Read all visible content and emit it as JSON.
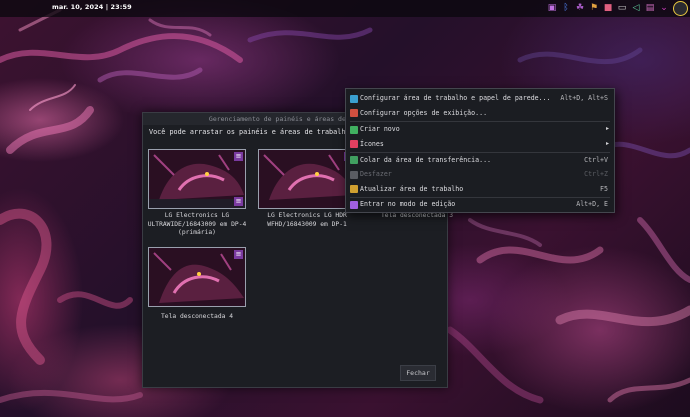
{
  "topbar": {
    "datetime": "mar. 10, 2024 | 23:59",
    "tray_icons": [
      "user-icon",
      "bluetooth-icon",
      "dragon-icon",
      "flag-icon",
      "lock-icon",
      "battery-icon",
      "volume-icon",
      "display-icon",
      "chevron-icon",
      "avatar-icon"
    ],
    "tray_colors": [
      "#c070e0",
      "#5080f0",
      "#b060d0",
      "#e0a040",
      "#e06080",
      "#d0d0d0",
      "#60d0a0",
      "#d070c0",
      "#d040c0",
      "#e8c840"
    ]
  },
  "dialog": {
    "title": "Gerenciamento de painéis e áreas de trabalho",
    "message": "Você pode arrastar os painéis e áreas de trabalho para outras telas.",
    "screens": [
      {
        "label": "LG Electronics LG ULTRAWIDE/16843009 em DP-4 (primária)",
        "has_image": true
      },
      {
        "label": "LG Electronics LG HDR WFHD/16843009 em DP-1",
        "has_image": true
      },
      {
        "label": "Tela desconectada 3",
        "has_image": false
      },
      {
        "label": "Tela desconectada 4",
        "has_image": true
      }
    ],
    "close_label": "Fechar",
    "menu_button_glyph": "≡"
  },
  "context_menu": {
    "items": [
      {
        "label": "Configurar área de trabalho e papel de parede...",
        "shortcut": "Alt+D, Alt+S",
        "icon": "desktop-settings-icon",
        "icon_color": "#3aa0d0",
        "submenu": false,
        "disabled": false
      },
      {
        "label": "Configurar opções de exibição...",
        "shortcut": "",
        "icon": "display-options-icon",
        "icon_color": "#d05040",
        "submenu": false,
        "disabled": false
      },
      {
        "label": "Criar novo",
        "shortcut": "",
        "icon": "create-new-icon",
        "icon_color": "#40b060",
        "submenu": true,
        "disabled": false
      },
      {
        "label": "Ícones",
        "shortcut": "",
        "icon": "icons-icon",
        "icon_color": "#e04060",
        "submenu": true,
        "disabled": false
      },
      {
        "label": "Colar da área de transferência...",
        "shortcut": "Ctrl+V",
        "icon": "paste-icon",
        "icon_color": "#40a060",
        "submenu": false,
        "disabled": false
      },
      {
        "label": "Desfazer",
        "shortcut": "Ctrl+Z",
        "icon": "undo-icon",
        "icon_color": "#5a5c62",
        "submenu": false,
        "disabled": true
      },
      {
        "label": "Atualizar área de trabalho",
        "shortcut": "F5",
        "icon": "refresh-icon",
        "icon_color": "#d0a030",
        "submenu": false,
        "disabled": false
      },
      {
        "label": "Entrar no modo de edição",
        "shortcut": "Alt+D, E",
        "icon": "edit-mode-icon",
        "icon_color": "#a060e0",
        "submenu": false,
        "disabled": false
      }
    ],
    "submenu_arrow": "▸"
  }
}
